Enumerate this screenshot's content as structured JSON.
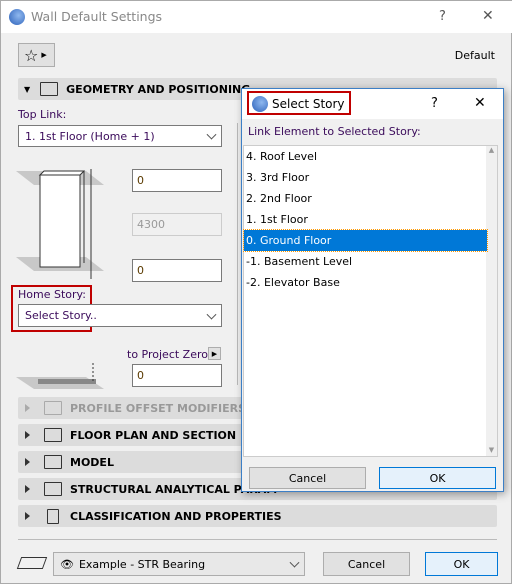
{
  "window": {
    "title": "Wall Default Settings",
    "help": "?",
    "close": "✕",
    "default_label": "Default"
  },
  "geometry": {
    "header": "GEOMETRY AND POSITIONING",
    "top_link_label": "Top Link:",
    "top_link_value": "1. 1st Floor (Home + 1)",
    "top_offset": "0",
    "height": "4300",
    "bottom_offset": "0",
    "home_story_label": "Home Story:",
    "home_story_value": "Select Story..",
    "to_project_zero_label": "to Project Zero",
    "project_zero_value": "0"
  },
  "sections": [
    {
      "label": "PROFILE OFFSET MODIFIERS",
      "enabled": false
    },
    {
      "label": "FLOOR PLAN AND SECTION",
      "enabled": true
    },
    {
      "label": "MODEL",
      "enabled": true
    },
    {
      "label": "STRUCTURAL ANALYTICAL PARAMETERS",
      "visible_label": "STRUCTURAL ANALYTICAL PARAM",
      "enabled": true
    },
    {
      "label": "CLASSIFICATION AND PROPERTIES",
      "enabled": true
    }
  ],
  "footer": {
    "layer_value": "Example - STR Bearing",
    "cancel": "Cancel",
    "ok": "OK"
  },
  "dialog": {
    "title": "Select Story",
    "help": "?",
    "close": "✕",
    "label": "Link Element to Selected Story:",
    "stories": [
      "4. Roof Level",
      "3. 3rd Floor",
      "2. 2nd Floor",
      "1. 1st Floor",
      "0. Ground Floor",
      "-1. Basement Level",
      "-2. Elevator Base"
    ],
    "selected_index": 4,
    "cancel": "Cancel",
    "ok": "OK"
  },
  "colors": {
    "accent": "#0078d7",
    "highlight_box": "#c00000"
  }
}
